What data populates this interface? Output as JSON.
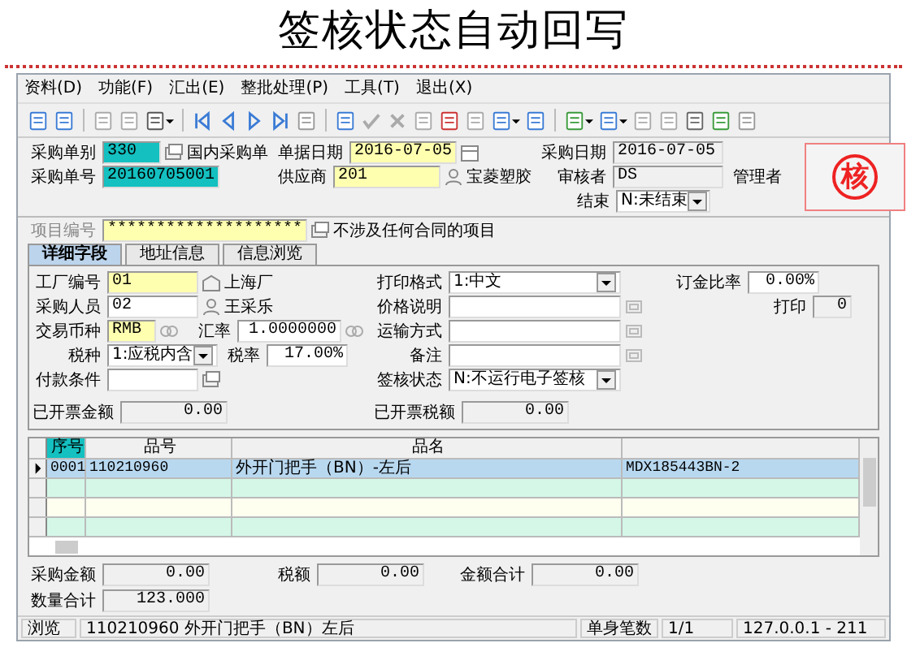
{
  "title": "签核状态自动回写",
  "menu": [
    "资料(D)",
    "功能(F)",
    "汇出(E)",
    "整批处理(P)",
    "工具(T)",
    "退出(X)"
  ],
  "header": {
    "purchase_type": {
      "label": "采购单别",
      "value": "330",
      "name": "国内采购单"
    },
    "doc_date": {
      "label": "单据日期",
      "value": "2016-07-05"
    },
    "purchase_date": {
      "label": "采购日期",
      "value": "2016-07-05"
    },
    "purchase_no": {
      "label": "采购单号",
      "value": "20160705001"
    },
    "supplier": {
      "label": "供应商",
      "value": "201",
      "name": "宝菱塑胶"
    },
    "reviewer": {
      "label": "审核者",
      "value": "DS",
      "name": "管理者"
    },
    "closed": {
      "label": "结束",
      "value": "N:未结束"
    },
    "stamp": "核"
  },
  "project": {
    "label": "项目编号",
    "value": "********************",
    "note": "不涉及任何合同的项目"
  },
  "tabs": [
    {
      "label": "详细字段",
      "selected": true
    },
    {
      "label": "地址信息",
      "selected": false
    },
    {
      "label": "信息浏览",
      "selected": false
    }
  ],
  "detail": {
    "factory": {
      "label": "工厂编号",
      "value": "01",
      "name": "上海厂"
    },
    "buyer": {
      "label": "采购人员",
      "value": "02",
      "name": "王采乐"
    },
    "currency": {
      "label": "交易币种",
      "value": "RMB"
    },
    "rate": {
      "label": "汇率",
      "value": "1.0000000"
    },
    "tax_type": {
      "label": "税种",
      "value": "1:应税内含"
    },
    "tax_rate": {
      "label": "税率",
      "value": "17.00%"
    },
    "payment": {
      "label": "付款条件"
    },
    "print_format": {
      "label": "打印格式",
      "value": "1:中文"
    },
    "price_note": {
      "label": "价格说明"
    },
    "shipping": {
      "label": "运输方式"
    },
    "remark": {
      "label": "备注"
    },
    "sign_status": {
      "label": "签核状态",
      "value": "N:不运行电子签核"
    },
    "deposit_rate": {
      "label": "订金比率",
      "value": "0.00%"
    },
    "print_count": {
      "label": "打印",
      "value": "0"
    },
    "invoiced_amount": {
      "label": "已开票金额",
      "value": "0.00"
    },
    "invoiced_tax": {
      "label": "已开票税额",
      "value": "0.00"
    }
  },
  "table": {
    "columns": [
      "序号",
      "品号",
      "品名"
    ],
    "rows": [
      {
        "cells": [
          "0001",
          "110210960",
          "外开门把手（BN）-左后",
          "MDX185443BN-2"
        ],
        "selected": true
      }
    ]
  },
  "totals": {
    "purchase_amount": {
      "label": "采购金额",
      "value": "0.00"
    },
    "tax": {
      "label": "税额",
      "value": "0.00"
    },
    "total": {
      "label": "金额合计",
      "value": "0.00"
    },
    "quantity": {
      "label": "数量合计",
      "value": "123.000"
    }
  },
  "status_bar": {
    "mode": "浏览",
    "message": "110210960 外开门把手（BN）左后",
    "count_label": "单身笔数",
    "count": "1/1",
    "server": "127.0.0.1 - 211"
  }
}
